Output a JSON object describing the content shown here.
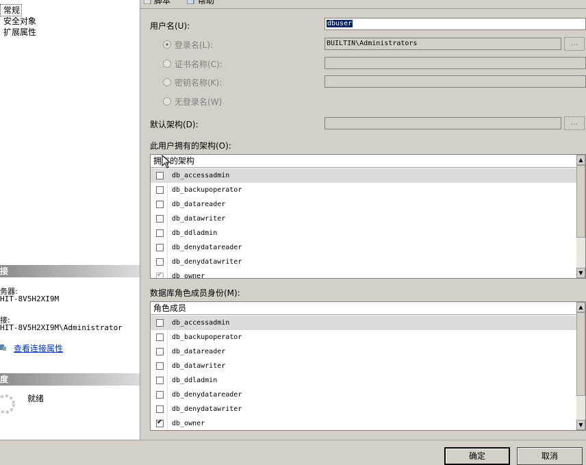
{
  "nav": {
    "items": [
      {
        "label": "常规",
        "selected": true
      },
      {
        "label": "安全对象",
        "selected": false
      },
      {
        "label": "扩展属性",
        "selected": false
      }
    ]
  },
  "connection": {
    "header": "接",
    "server_label": "务器:",
    "server_value": "HIT-8V5H2XI9M",
    "conn_label": "接:",
    "conn_value": "HIT-8V5H2XI9M\\Administrator",
    "link": "查看连接属性"
  },
  "progress": {
    "header": "度",
    "status": "就绪"
  },
  "toolbar": {
    "script_label": "脚本",
    "help_label": "帮助"
  },
  "form": {
    "username_label": "用户名(U):",
    "username_value": "dbuser",
    "login_label": "登录名(L):",
    "login_value": "BUILTIN\\Administrators",
    "cert_label": "证书名称(C):",
    "key_label": "密钥名称(K):",
    "nologin_label": "无登录名(W)",
    "schema_label": "默认架构(D):",
    "browse_label": "..."
  },
  "owned_schemas": {
    "label": "此用户拥有的架构(O):",
    "column": "拥有的架构",
    "rows": [
      {
        "name": "db_accessadmin",
        "checked": false
      },
      {
        "name": "db_backupoperator",
        "checked": false
      },
      {
        "name": "db_datareader",
        "checked": false
      },
      {
        "name": "db_datawriter",
        "checked": false
      },
      {
        "name": "db_ddladmin",
        "checked": false
      },
      {
        "name": "db_denydatareader",
        "checked": false
      },
      {
        "name": "db_denydatawriter",
        "checked": false
      },
      {
        "name": "db_owner",
        "checked": true
      }
    ]
  },
  "role_members": {
    "label": "数据库角色成员身份(M):",
    "column": "角色成员",
    "rows": [
      {
        "name": "db_accessadmin",
        "checked": false
      },
      {
        "name": "db_backupoperator",
        "checked": false
      },
      {
        "name": "db_datareader",
        "checked": false
      },
      {
        "name": "db_datawriter",
        "checked": false
      },
      {
        "name": "db_ddladmin",
        "checked": false
      },
      {
        "name": "db_denydatareader",
        "checked": false
      },
      {
        "name": "db_denydatawriter",
        "checked": false
      },
      {
        "name": "db_owner",
        "checked": true
      }
    ]
  },
  "buttons": {
    "ok": "确定",
    "cancel": "取消"
  }
}
